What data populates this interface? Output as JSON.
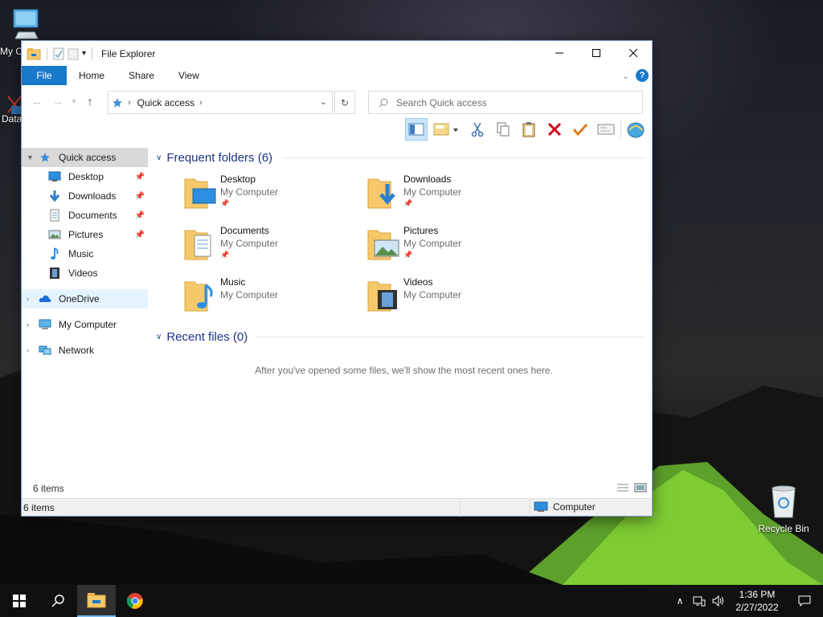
{
  "desktop": {
    "icons": [
      {
        "label": "My C",
        "icon": "my-computer-icon"
      },
      {
        "label": "Data",
        "icon": "data-icon"
      },
      {
        "label": "Recycle Bin",
        "icon": "recycle-bin-icon"
      }
    ]
  },
  "window": {
    "title": "File Explorer",
    "tabs": {
      "file": "File",
      "home": "Home",
      "share": "Share",
      "view": "View"
    },
    "help": "?",
    "address": {
      "crumb": "Quick access"
    },
    "search": {
      "placeholder": "Search Quick access"
    }
  },
  "nav": {
    "quick_access": "Quick access",
    "children": [
      {
        "label": "Desktop",
        "icon": "desktop-icon",
        "pinned": true
      },
      {
        "label": "Downloads",
        "icon": "downloads-icon",
        "pinned": true
      },
      {
        "label": "Documents",
        "icon": "documents-icon",
        "pinned": true
      },
      {
        "label": "Pictures",
        "icon": "pictures-icon",
        "pinned": true
      },
      {
        "label": "Music",
        "icon": "music-icon",
        "pinned": false
      },
      {
        "label": "Videos",
        "icon": "videos-icon",
        "pinned": false
      }
    ],
    "onedrive": "OneDrive",
    "my_computer": "My Computer",
    "network": "Network"
  },
  "main": {
    "frequent_header": "Frequent folders (6)",
    "folders": [
      {
        "name": "Desktop",
        "location": "My Computer",
        "pinned": true
      },
      {
        "name": "Downloads",
        "location": "My Computer",
        "pinned": true
      },
      {
        "name": "Documents",
        "location": "My Computer",
        "pinned": true
      },
      {
        "name": "Pictures",
        "location": "My Computer",
        "pinned": true
      },
      {
        "name": "Music",
        "location": "My Computer",
        "pinned": false
      },
      {
        "name": "Videos",
        "location": "My Computer",
        "pinned": false
      }
    ],
    "recent_header": "Recent files (0)",
    "recent_empty": "After you've opened some files, we'll show the most recent ones here."
  },
  "status": {
    "items_line": "6 items",
    "bar_left": "6 items",
    "zone": "Computer"
  },
  "taskbar": {
    "time": "1:36 PM",
    "date": "2/27/2022"
  },
  "colors": {
    "accent": "#1979ca",
    "folder": "#f5c96b",
    "section_text": "#1e3287"
  }
}
